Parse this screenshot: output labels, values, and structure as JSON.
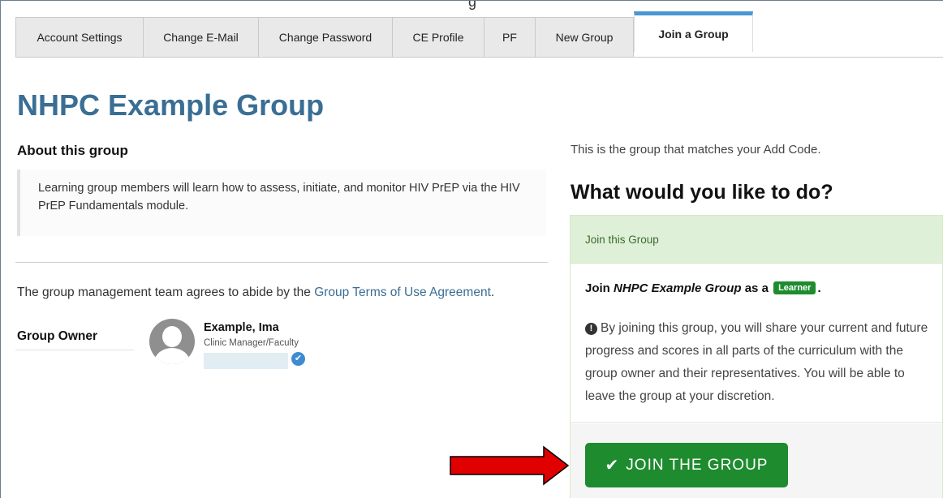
{
  "top_strip": "g",
  "tabs": [
    {
      "label": "Account Settings",
      "active": false
    },
    {
      "label": "Change E-Mail",
      "active": false
    },
    {
      "label": "Change Password",
      "active": false
    },
    {
      "label": "CE Profile",
      "active": false
    },
    {
      "label": "PF",
      "active": false
    },
    {
      "label": "New Group",
      "active": false
    },
    {
      "label": "Join a Group",
      "active": true
    }
  ],
  "group": {
    "title": "NHPC Example Group",
    "about_heading": "About this group",
    "description": "Learning group members will learn how to assess, initiate, and monitor HIV PrEP via the HIV PrEP Fundamentals module.",
    "agreement_prefix": "The group management team agrees to abide by the ",
    "agreement_link": "Group Terms of Use Agreement",
    "agreement_suffix": ".",
    "owner_label": "Group Owner",
    "owner_name": "Example, Ima",
    "owner_role": "Clinic Manager/Faculty"
  },
  "join": {
    "matches_text": "This is the group that matches your Add Code.",
    "question": "What would you like to do?",
    "panel_title": "Join this Group",
    "join_prefix": "Join ",
    "join_group_name": "NHPC Example Group",
    "join_mid": " as a ",
    "role_badge": "Learner",
    "join_suffix": ".",
    "notice": "By joining this group, you will share your current and future progress and scores in all parts of the curriculum with the group owner and their representatives. You will be able to leave the group at your discretion.",
    "button_label": "JOIN THE GROUP"
  },
  "colors": {
    "title": "#3a6e94",
    "link": "#3a6e94",
    "success": "#1e8c2e",
    "panel_head_bg": "#dff0d8",
    "tab_active_border": "#4a97d2",
    "annotation_arrow": "#e00000"
  },
  "icons": {
    "avatar": "user-silhouette-icon",
    "verified": "checkmark-badge-icon",
    "notice": "exclamation-circle-icon",
    "button": "checkmark-icon",
    "annotation": "red-arrow-icon"
  }
}
